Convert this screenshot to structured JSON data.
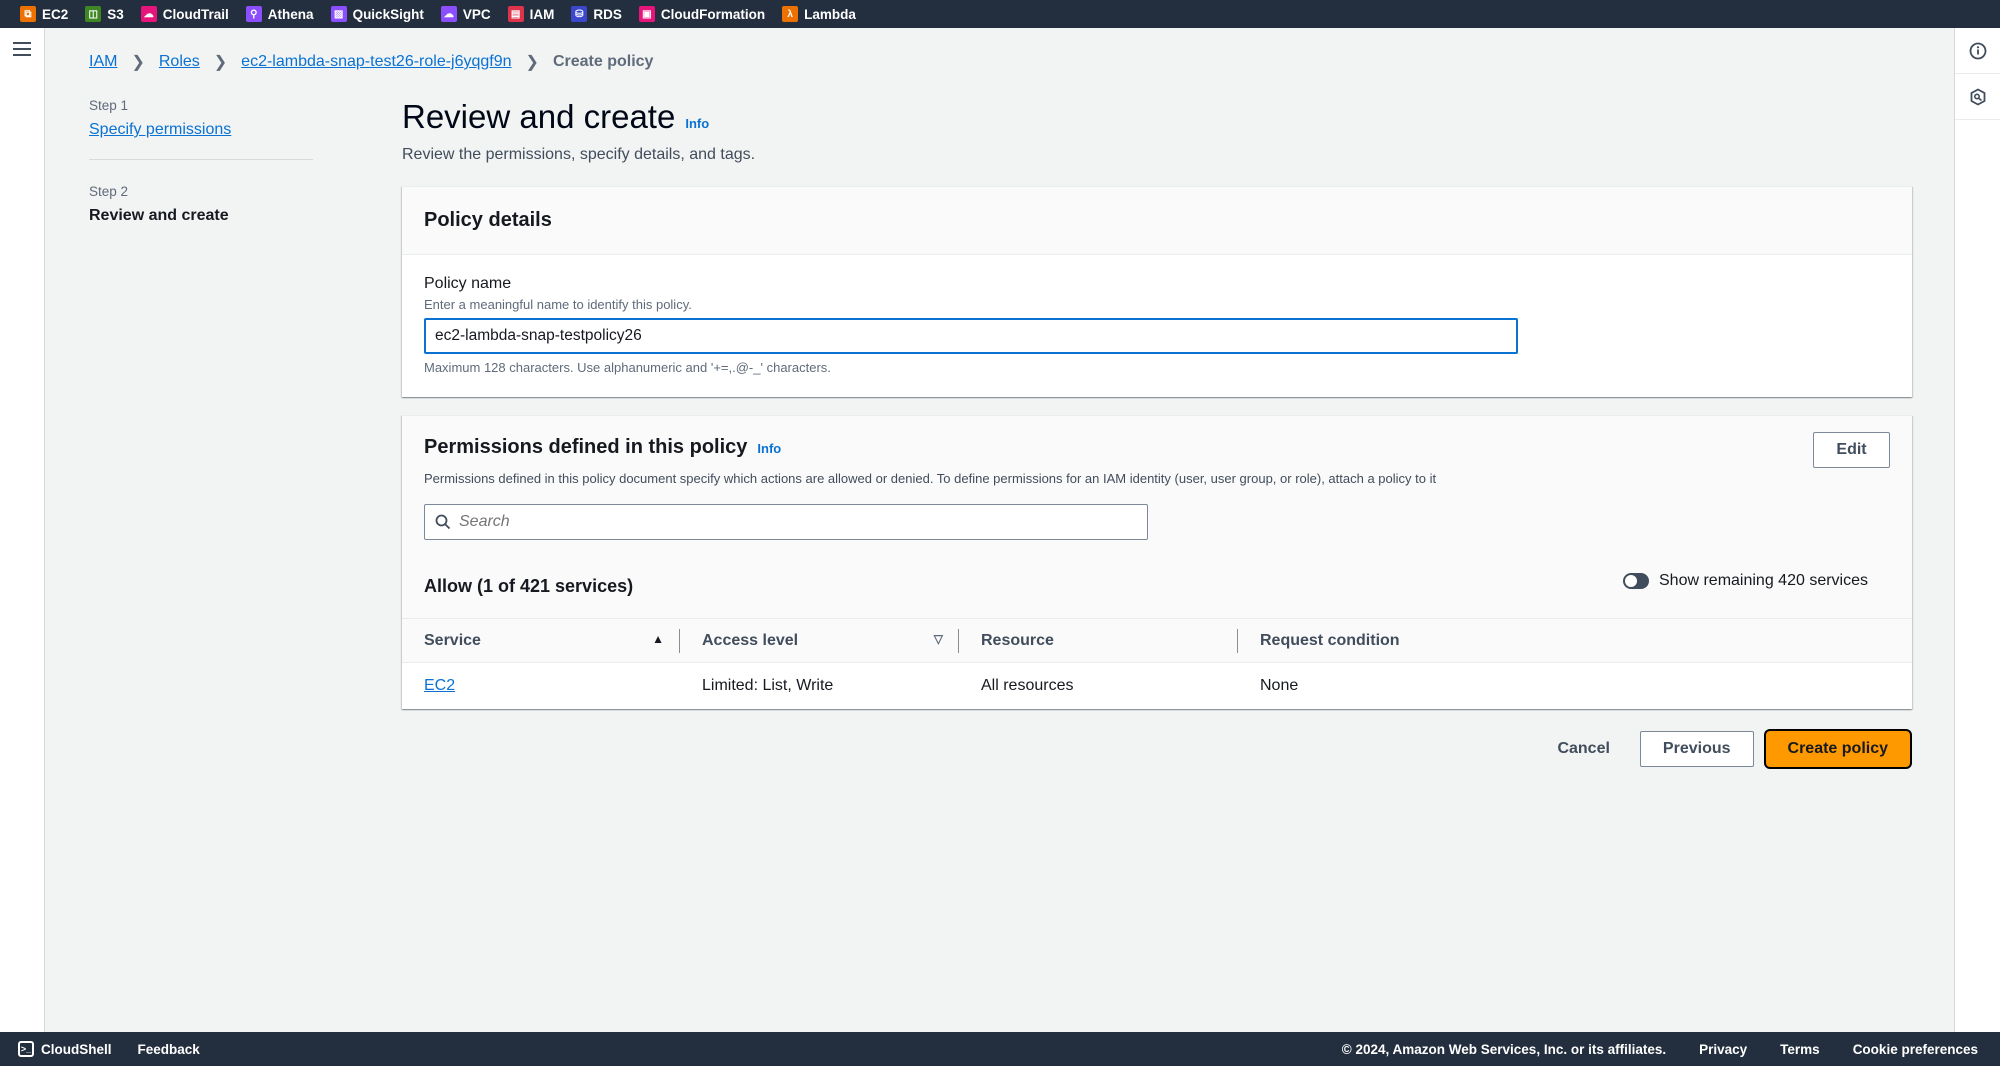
{
  "topbar": {
    "favorites": [
      {
        "label": "EC2",
        "icon": "ec2-icon",
        "color": "#ed7100"
      },
      {
        "label": "S3",
        "icon": "s3-icon",
        "color": "#3f8624"
      },
      {
        "label": "CloudTrail",
        "icon": "cloudtrail-icon",
        "color": "#e7157b"
      },
      {
        "label": "Athena",
        "icon": "athena-icon",
        "color": "#8c4fff"
      },
      {
        "label": "QuickSight",
        "icon": "quicksight-icon",
        "color": "#8c4fff"
      },
      {
        "label": "VPC",
        "icon": "vpc-icon",
        "color": "#8c4fff"
      },
      {
        "label": "IAM",
        "icon": "iam-icon",
        "color": "#dd344c"
      },
      {
        "label": "RDS",
        "icon": "rds-icon",
        "color": "#3b48cc"
      },
      {
        "label": "CloudFormation",
        "icon": "cloudformation-icon",
        "color": "#e7157b"
      },
      {
        "label": "Lambda",
        "icon": "lambda-icon",
        "color": "#ed7100"
      }
    ]
  },
  "breadcrumb": {
    "items": [
      "IAM",
      "Roles",
      "ec2-lambda-snap-test26-role-j6yqgf9n"
    ],
    "current": "Create policy"
  },
  "steps": {
    "step1_label": "Step 1",
    "step1_title": "Specify permissions",
    "step2_label": "Step 2",
    "step2_title": "Review and create"
  },
  "page": {
    "title": "Review and create",
    "info": "Info",
    "description": "Review the permissions, specify details, and tags."
  },
  "policy_details": {
    "header": "Policy details",
    "name_label": "Policy name",
    "name_desc": "Enter a meaningful name to identify this policy.",
    "name_value": "ec2-lambda-snap-testpolicy26",
    "name_constraint": "Maximum 128 characters. Use alphanumeric and '+=,.@-_' characters."
  },
  "permissions": {
    "header": "Permissions defined in this policy",
    "info": "Info",
    "description": "Permissions defined in this policy document specify which actions are allowed or denied. To define permissions for an IAM identity (user, user group, or role), attach a policy to it",
    "edit_label": "Edit",
    "search_placeholder": "Search",
    "allow_title": "Allow (1 of 421 services)",
    "toggle_label": "Show remaining 420 services",
    "toggle_on": false,
    "columns": [
      "Service",
      "Access level",
      "Resource",
      "Request condition"
    ],
    "rows": [
      {
        "service": "EC2",
        "access_level": "Limited: List, Write",
        "resource": "All resources",
        "request_condition": "None"
      }
    ]
  },
  "actions": {
    "cancel": "Cancel",
    "previous": "Previous",
    "create": "Create policy"
  },
  "footer": {
    "cloudshell": "CloudShell",
    "feedback": "Feedback",
    "copyright": "© 2024, Amazon Web Services, Inc. or its affiliates.",
    "privacy": "Privacy",
    "terms": "Terms",
    "cookies": "Cookie preferences"
  }
}
